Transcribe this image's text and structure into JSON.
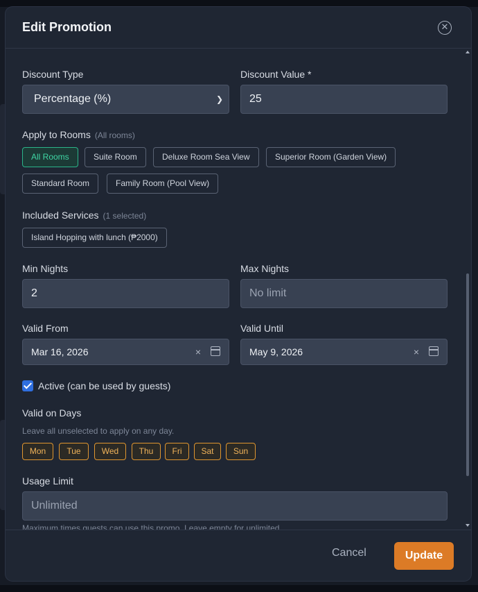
{
  "modal": {
    "title": "Edit Promotion"
  },
  "discount": {
    "type_label": "Discount Type",
    "type_value": "Percentage (%)",
    "value_label": "Discount Value *",
    "value": "25"
  },
  "rooms": {
    "label": "Apply to Rooms",
    "hint": "(All rooms)",
    "chips": [
      "All Rooms",
      "Suite Room",
      "Deluxe Room Sea View",
      "Superior Room (Garden View)",
      "Standard Room",
      "Family Room (Pool View)"
    ]
  },
  "services": {
    "label": "Included Services",
    "hint": "(1 selected)",
    "chips": [
      "Island Hopping with lunch (₱2000)"
    ]
  },
  "nights": {
    "min_label": "Min Nights",
    "min_value": "2",
    "max_label": "Max Nights",
    "max_placeholder": "No limit"
  },
  "validity": {
    "from_label": "Valid From",
    "from_value": "Mar 16, 2026",
    "until_label": "Valid Until",
    "until_value": "May 9, 2026",
    "clear": "×"
  },
  "active": {
    "label": "Active (can be used by guests)",
    "checked": true
  },
  "days": {
    "label": "Valid on Days",
    "hint": "Leave all unselected to apply on any day.",
    "items": [
      "Mon",
      "Tue",
      "Wed",
      "Thu",
      "Fri",
      "Sat",
      "Sun"
    ]
  },
  "usage": {
    "label": "Usage Limit",
    "placeholder": "Unlimited",
    "hint": "Maximum times guests can use this promo. Leave empty for unlimited."
  },
  "footer": {
    "cancel": "Cancel",
    "update": "Update"
  },
  "colors": {
    "accent": "#dc7b26",
    "selected_chip": "#2bb58a",
    "day_chip": "#e0962f",
    "modal_bg": "#1f2633"
  },
  "icons": {
    "close": "close-circle-icon",
    "calendar": "calendar-icon",
    "chevron": "chevron-down-icon"
  }
}
